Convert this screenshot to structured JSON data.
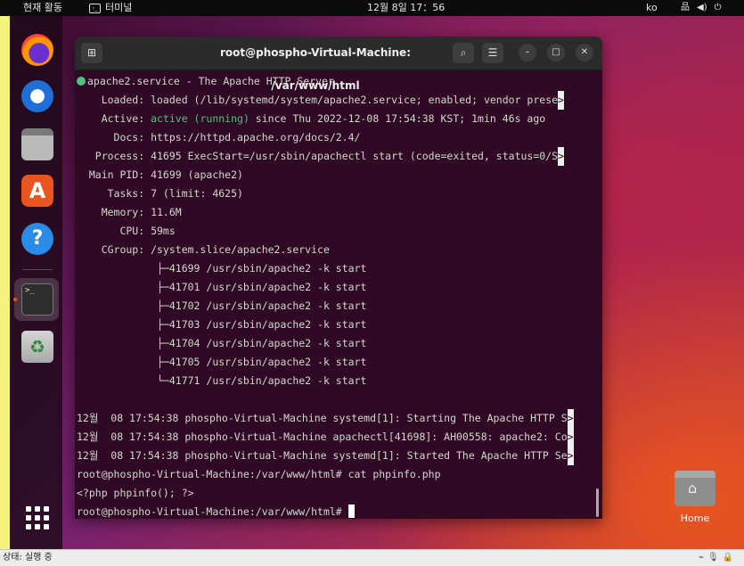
{
  "topbar": {
    "activities": "현재 활동",
    "app_name": "터미널",
    "clock": "12월 8일  17：56",
    "lang": "ko",
    "tray_icons": [
      "network-icon",
      "volume-icon",
      "power-icon"
    ]
  },
  "dock": {
    "items": [
      "firefox",
      "thunderbird",
      "files",
      "app-center",
      "help",
      "terminal",
      "trash",
      "show-apps"
    ],
    "terminal_icon_text": ">_"
  },
  "window": {
    "title": "root@phospho-Virtual-Machine: /var/www/html"
  },
  "terminal": {
    "service_line": "apache2.service - The Apache HTTP Server",
    "loaded": "    Loaded: loaded (/lib/systemd/system/apache2.service; enabled; vendor prese",
    "active_label": "    Active: ",
    "active_status": "active (running)",
    "active_rest": " since Thu 2022-12-08 17:54:38 KST; 1min 46s ago",
    "docs": "      Docs: https://httpd.apache.org/docs/2.4/",
    "process": "   Process: 41695 ExecStart=/usr/sbin/apachectl start (code=exited, status=0/S",
    "main_pid": "  Main PID: 41699 (apache2)",
    "tasks": "     Tasks: 7 (limit: 4625)",
    "memory": "    Memory: 11.6M",
    "cpu": "       CPU: 59ms",
    "cgroup": "    CGroup: /system.slice/apache2.service",
    "cgroup_procs": [
      "             ├─41699 /usr/sbin/apache2 -k start",
      "             ├─41701 /usr/sbin/apache2 -k start",
      "             ├─41702 /usr/sbin/apache2 -k start",
      "             ├─41703 /usr/sbin/apache2 -k start",
      "             ├─41704 /usr/sbin/apache2 -k start",
      "             ├─41705 /usr/sbin/apache2 -k start",
      "             └─41771 /usr/sbin/apache2 -k start"
    ],
    "log_lines": [
      "12월  08 17:54:38 phospho-Virtual-Machine systemd[1]: Starting The Apache HTTP S",
      "12월  08 17:54:38 phospho-Virtual-Machine apachectl[41698]: AH00558: apache2: Co",
      "12월  08 17:54:38 phospho-Virtual-Machine systemd[1]: Started The Apache HTTP Se"
    ],
    "cmd_line": "root@phospho-Virtual-Machine:/var/www/html# cat phpinfo.php",
    "output_line": "<?php phpinfo(); ?>",
    "prompt": "root@phospho-Virtual-Machine:/var/www/html# ",
    "trunc_marker": ">"
  },
  "desktop": {
    "home_label": "Home"
  },
  "statusbar": {
    "text": "상태: 실행 중"
  },
  "colors": {
    "terminal_bg": "#300a24",
    "active_green": "#4fc07f",
    "accent": "#e95420"
  }
}
